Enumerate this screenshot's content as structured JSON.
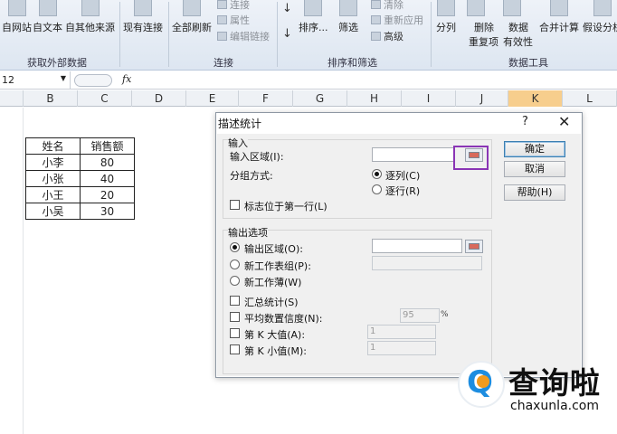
{
  "ribbon": {
    "buttons": [
      {
        "key": "from_web",
        "label": "自网站"
      },
      {
        "key": "from_text",
        "label": "自文本"
      },
      {
        "key": "from_other",
        "label": "自其他来源"
      },
      {
        "key": "existing_conn",
        "label": "现有连接"
      },
      {
        "key": "refresh_all",
        "label": "全部刷新"
      },
      {
        "key": "sort",
        "label": "排序..."
      },
      {
        "key": "filter",
        "label": "筛选"
      },
      {
        "key": "split",
        "label": "分列"
      },
      {
        "key": "remove_dup",
        "label": "删除\n重复项"
      },
      {
        "key": "validation",
        "label": "数据\n有效性"
      },
      {
        "key": "consolidate",
        "label": "合并计算"
      },
      {
        "key": "whatif",
        "label": "假设分析"
      }
    ],
    "small_items": {
      "connections": "连接",
      "properties": "属性",
      "edit_links": "编辑链接",
      "clear": "清除",
      "reapply": "重新应用",
      "advanced": "高级"
    },
    "groups": {
      "get_external": "获取外部数据",
      "connections": "连接",
      "sort_filter": "排序和筛选",
      "data_tools": "数据工具"
    }
  },
  "formula_bar": {
    "name_box": "12",
    "fx": "fx"
  },
  "columns": [
    "B",
    "C",
    "D",
    "E",
    "F",
    "G",
    "H",
    "I",
    "J",
    "K",
    "L"
  ],
  "selected_column": "K",
  "table": {
    "headers": [
      "姓名",
      "销售额"
    ],
    "rows": [
      [
        "小李",
        "80"
      ],
      [
        "小张",
        "40"
      ],
      [
        "小王",
        "20"
      ],
      [
        "小吴",
        "30"
      ]
    ]
  },
  "dialog": {
    "title": "描述统计",
    "help_glyph": "?",
    "close_glyph": "✕",
    "input_section": "输入",
    "input_range_label": "输入区域(I):",
    "grouping_label": "分组方式:",
    "by_column": "逐列(C)",
    "by_row": "逐行(R)",
    "labels_first_row": "标志位于第一行(L)",
    "output_section": "输出选项",
    "output_range": "输出区域(O):",
    "new_sheet": "新工作表组(P):",
    "new_workbook": "新工作薄(W)",
    "summary_stats": "汇总统计(S)",
    "confidence": "平均数置信度(N):",
    "confidence_value": "95",
    "percent_sign": "%",
    "kth_largest": "第 K 大值(A):",
    "kth_largest_value": "1",
    "kth_smallest": "第 K 小值(M):",
    "kth_smallest_value": "1",
    "ok": "确定",
    "cancel": "取消",
    "help": "帮助(H)"
  },
  "watermark": {
    "brand": "查询啦",
    "url": "chaxunla.com"
  }
}
